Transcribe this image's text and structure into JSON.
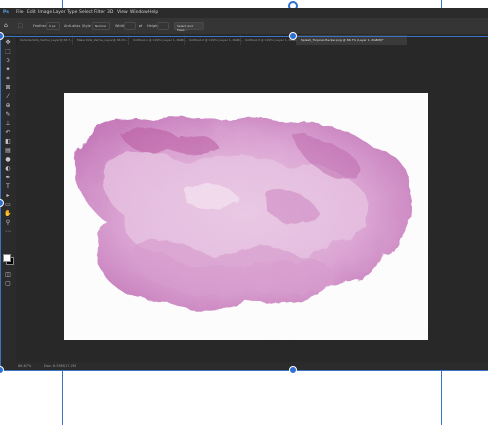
{
  "menu": {
    "file": "File",
    "edit": "Edit",
    "image": "Image",
    "layer": "Layer",
    "type": "Type",
    "select": "Select",
    "filter": "Filter",
    "three_d": "3D",
    "view": "View",
    "window": "Window",
    "help": "Help"
  },
  "options": {
    "feather_label": "Feather",
    "feather_value": "0 px",
    "antialias_label": "Anti-alias",
    "style_label": "Style",
    "style_value": "Normal",
    "width_label": "Width",
    "height_label": "Height",
    "select_mask_label": "Select and Mask..."
  },
  "tabs": [
    {
      "label": "Outside Kids_Verfus_Layer@ 66.7..."
    },
    {
      "label": "Make Kids_Verfus_Layer@ 66.70..."
    },
    {
      "label": "Untitled-1 @ 100% (Layer 1, RGB/..."
    },
    {
      "label": "Untitled-2 @ 100% (Layer 1, RGB/..."
    },
    {
      "label": "Untitled-3 @ 100% (Layer 1, RGB/..."
    },
    {
      "label": "Splash_Tropical-Hacker.png @ 66.7% (Layer 1, RGB/8)*"
    }
  ],
  "status": {
    "zoom": "66.67%",
    "doc_size": "Doc: 6.59M/17.2M"
  },
  "colors": {
    "accent": "#2f6fd1",
    "ps_background": "#323232",
    "canvas_background": "#282828",
    "splash_primary": "#c46fb7",
    "splash_light": "#e7bfe0"
  }
}
